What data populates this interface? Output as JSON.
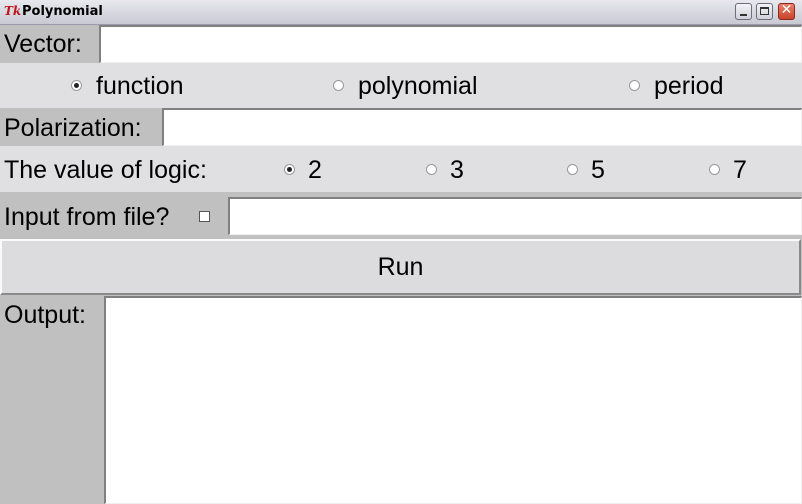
{
  "window": {
    "title": "Polynomial",
    "logo": "Tk"
  },
  "vector": {
    "label": "Vector:",
    "value": ""
  },
  "mode": {
    "selected": "function",
    "options": [
      {
        "label": "function",
        "selected": true
      },
      {
        "label": "polynomial",
        "selected": false
      },
      {
        "label": "period",
        "selected": false
      }
    ]
  },
  "polarization": {
    "label": "Polarization:",
    "value": ""
  },
  "logic": {
    "label": "The value of logic:",
    "selected": "2",
    "options": [
      {
        "label": "2",
        "selected": true
      },
      {
        "label": "3",
        "selected": false
      },
      {
        "label": "5",
        "selected": false
      },
      {
        "label": "7",
        "selected": false
      }
    ]
  },
  "file_input": {
    "label": "Input from file?",
    "checked": false,
    "value": ""
  },
  "run": {
    "label": "Run"
  },
  "output": {
    "label": "Output:",
    "value": ""
  },
  "colors": {
    "background": "#c0c0c0",
    "radio_row": "#e0e0e3",
    "entry": "#ffffff",
    "close": "#c9442b"
  }
}
